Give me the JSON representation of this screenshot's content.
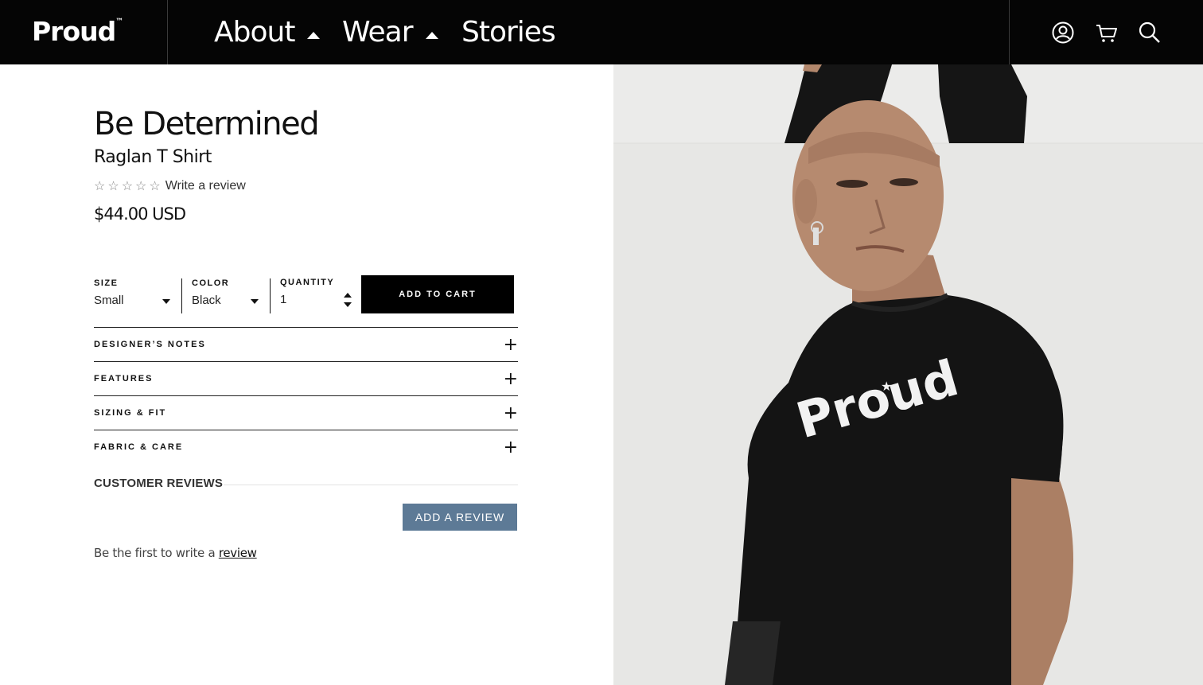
{
  "header": {
    "logo": "Proud",
    "logo_mark": "™",
    "nav": [
      {
        "label": "About",
        "has_dropdown": true
      },
      {
        "label": "Wear",
        "has_dropdown": true
      },
      {
        "label": "Stories",
        "has_dropdown": false
      }
    ],
    "icons": [
      "account-icon",
      "cart-icon",
      "search-icon"
    ]
  },
  "product": {
    "title": "Be Determined",
    "subtitle": "Raglan T Shirt",
    "rating_stars": 0,
    "rating_max": 5,
    "write_review": "Write a review",
    "price": "$44.00 USD"
  },
  "options": {
    "size_label": "SIZE",
    "size_value": "Small",
    "color_label": "COLOR",
    "color_value": "Black",
    "quantity_label": "QUANTITY",
    "quantity_value": "1",
    "add_to_cart": "ADD TO CART"
  },
  "accordion": [
    {
      "label": "DESIGNER’S NOTES"
    },
    {
      "label": "FEATURES"
    },
    {
      "label": "SIZING & FIT"
    },
    {
      "label": "FABRIC & CARE"
    }
  ],
  "reviews": {
    "title": "CUSTOMER REVIEWS",
    "add_button": "ADD A REVIEW",
    "empty_prefix": "Be the first to write a ",
    "empty_link": "review"
  },
  "photo": {
    "shirt_print": "Proud"
  },
  "colors": {
    "header_bg": "#050505",
    "button_black": "#000000",
    "review_button": "#5d7a96",
    "photo_bg": "#e8e8e6"
  }
}
